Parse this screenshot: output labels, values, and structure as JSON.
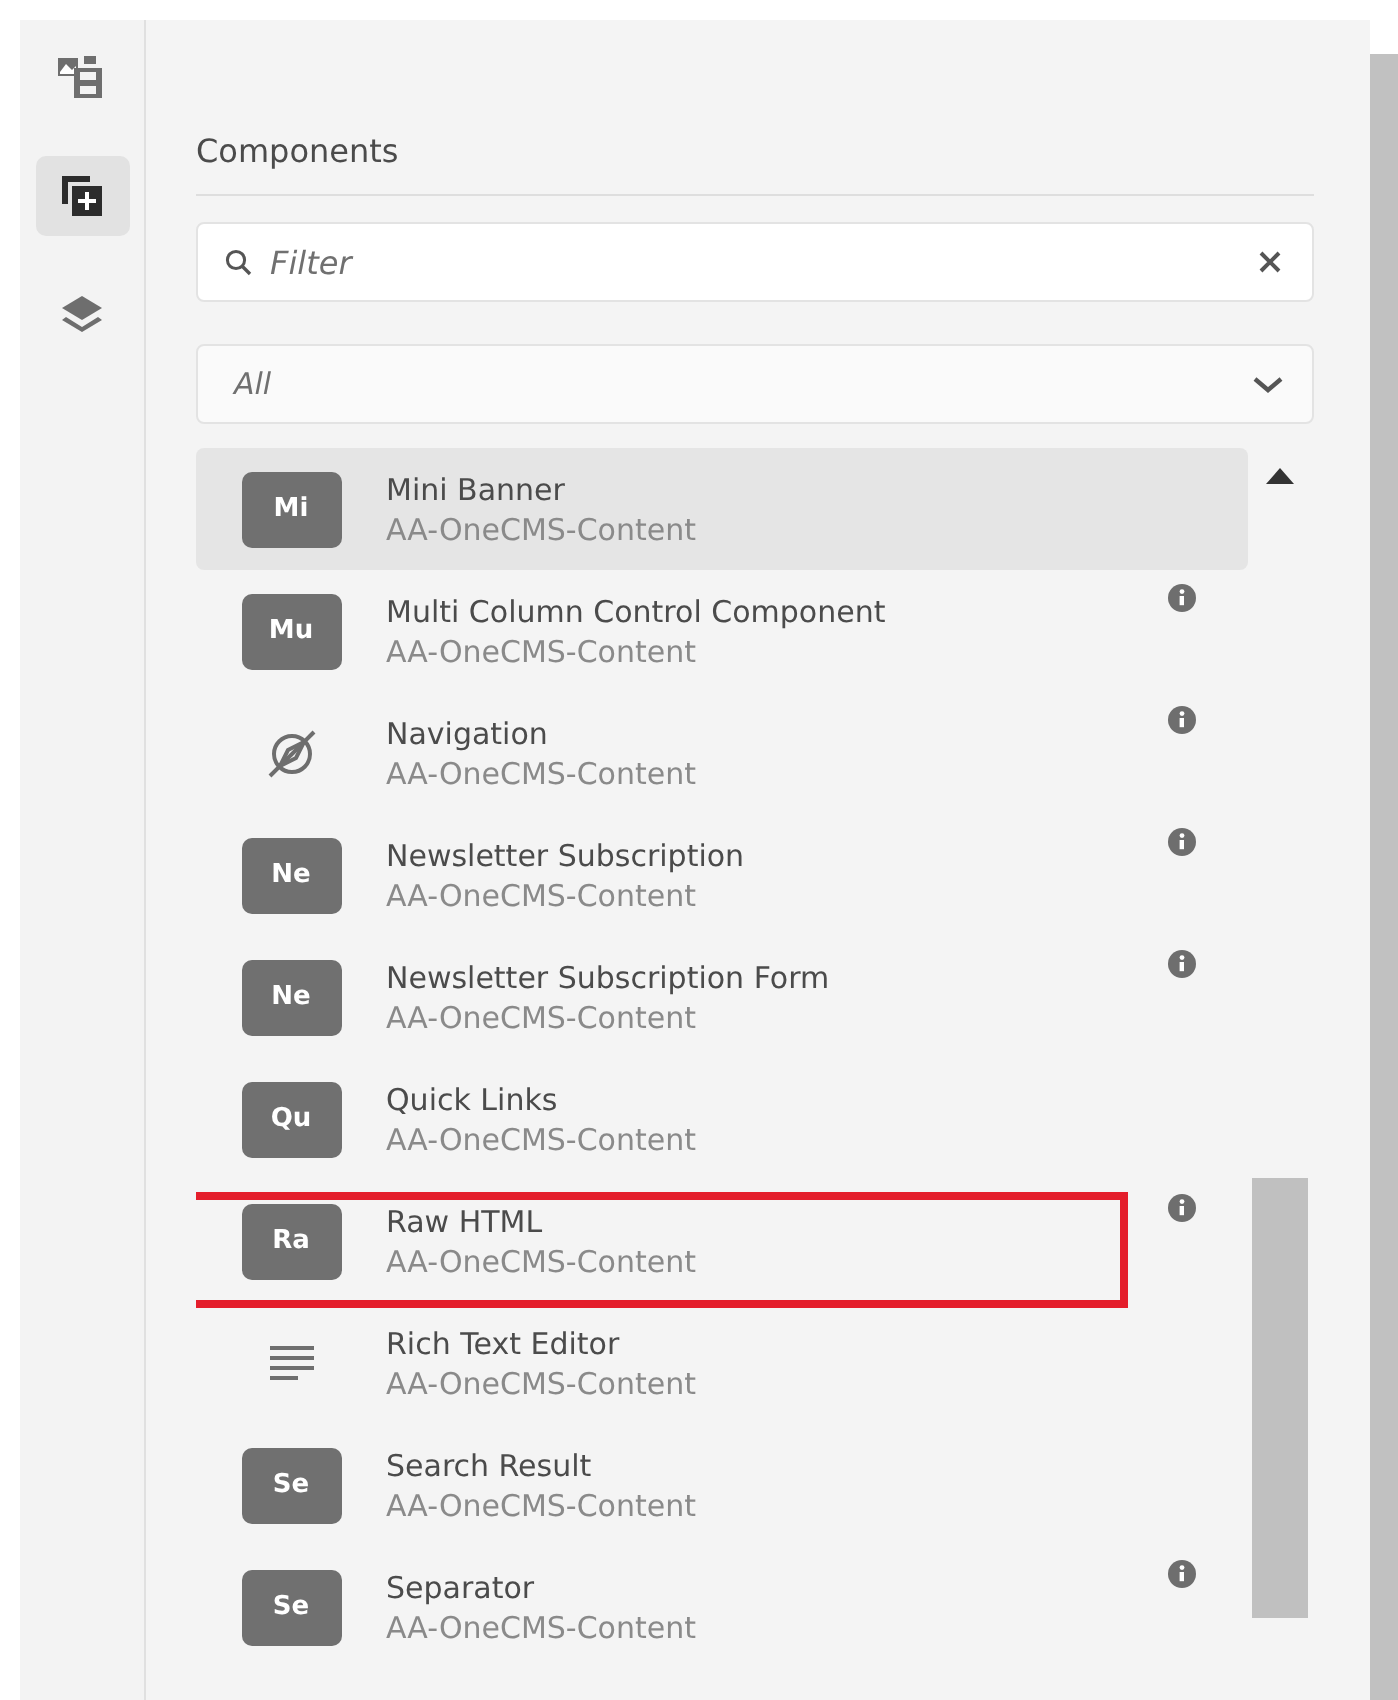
{
  "sidebar": {
    "items": [
      {
        "kind": "assets",
        "selected": false
      },
      {
        "kind": "components",
        "selected": true
      },
      {
        "kind": "layers",
        "selected": false
      }
    ]
  },
  "panel": {
    "title": "Components",
    "filter": {
      "placeholder": "Filter"
    },
    "group_select": {
      "value": "All"
    },
    "components": [
      {
        "kind": "badge",
        "badge": "Mi",
        "name": "Mini Banner",
        "group": "AA-OneCMS-Content",
        "hovered": true,
        "info": false,
        "highlighted": false
      },
      {
        "kind": "badge",
        "badge": "Mu",
        "name": "Multi Column Control Component",
        "group": "AA-OneCMS-Content",
        "hovered": false,
        "info": true,
        "highlighted": false
      },
      {
        "kind": "compass",
        "name": "Navigation",
        "group": "AA-OneCMS-Content",
        "hovered": false,
        "info": true,
        "highlighted": false
      },
      {
        "kind": "badge",
        "badge": "Ne",
        "name": "Newsletter Subscription",
        "group": "AA-OneCMS-Content",
        "hovered": false,
        "info": true,
        "highlighted": false
      },
      {
        "kind": "badge",
        "badge": "Ne",
        "name": "Newsletter Subscription Form",
        "group": "AA-OneCMS-Content",
        "hovered": false,
        "info": true,
        "highlighted": false
      },
      {
        "kind": "badge",
        "badge": "Qu",
        "name": "Quick Links",
        "group": "AA-OneCMS-Content",
        "hovered": false,
        "info": false,
        "highlighted": false
      },
      {
        "kind": "badge",
        "badge": "Ra",
        "name": "Raw HTML",
        "group": "AA-OneCMS-Content",
        "hovered": false,
        "info": true,
        "highlighted": true
      },
      {
        "kind": "text",
        "name": "Rich Text Editor",
        "group": "AA-OneCMS-Content",
        "hovered": false,
        "info": false,
        "highlighted": false
      },
      {
        "kind": "badge",
        "badge": "Se",
        "name": "Search Result",
        "group": "AA-OneCMS-Content",
        "hovered": false,
        "info": false,
        "highlighted": false
      },
      {
        "kind": "badge",
        "badge": "Se",
        "name": "Separator",
        "group": "AA-OneCMS-Content",
        "hovered": false,
        "info": true,
        "highlighted": false
      }
    ]
  }
}
